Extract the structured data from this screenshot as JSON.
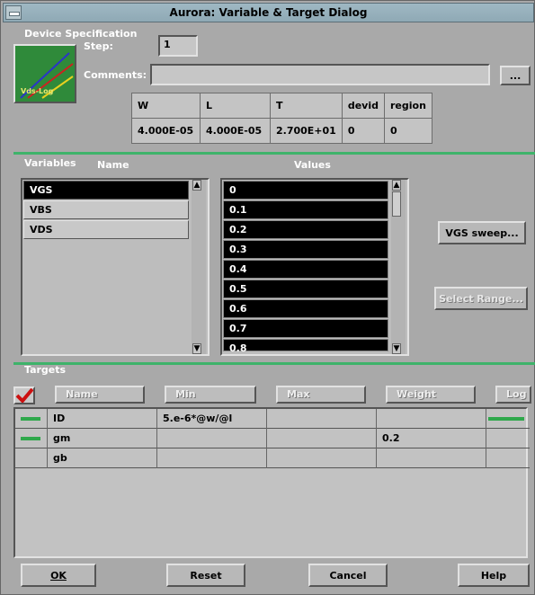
{
  "window": {
    "title": "Aurora: Variable & Target Dialog"
  },
  "device": {
    "section_label": "Device Specification",
    "step_label": "Step:",
    "step_value": "1",
    "comments_label": "Comments:",
    "comments_value": "",
    "comments_browse": "...",
    "thumbnail_caption": "Vds-Log",
    "params": {
      "headers": [
        "W",
        "L",
        "T",
        "devid",
        "region"
      ],
      "values": [
        "4.000E-05",
        "4.000E-05",
        "2.700E+01",
        "0",
        "0"
      ]
    }
  },
  "variables": {
    "section_label": "Variables",
    "name_header": "Name",
    "values_header": "Values",
    "names": [
      "VGS",
      "VBS",
      "VDS"
    ],
    "selected": "VGS",
    "values": [
      "0",
      "0.1",
      "0.2",
      "0.3",
      "0.4",
      "0.5",
      "0.6",
      "0.7",
      "0.8"
    ],
    "sweep_button": "VGS sweep...",
    "select_range_button": "Select Range..."
  },
  "targets": {
    "section_label": "Targets",
    "columns": [
      "Name",
      "Min",
      "Max",
      "Weight",
      "Log"
    ],
    "rows": [
      {
        "name": "ID",
        "min": "5.e-6*@w/@l",
        "max": "",
        "weight": "",
        "active": true,
        "log": true
      },
      {
        "name": "gm",
        "min": "",
        "max": "",
        "weight": "0.2",
        "active": true,
        "log": false
      },
      {
        "name": "gb",
        "min": "",
        "max": "",
        "weight": "",
        "active": false,
        "log": false
      }
    ]
  },
  "buttons": {
    "ok": "OK",
    "reset": "Reset",
    "cancel": "Cancel",
    "help": "Help"
  },
  "colors": {
    "accent_green": "#3eb36a",
    "check_red": "#cc1010"
  }
}
